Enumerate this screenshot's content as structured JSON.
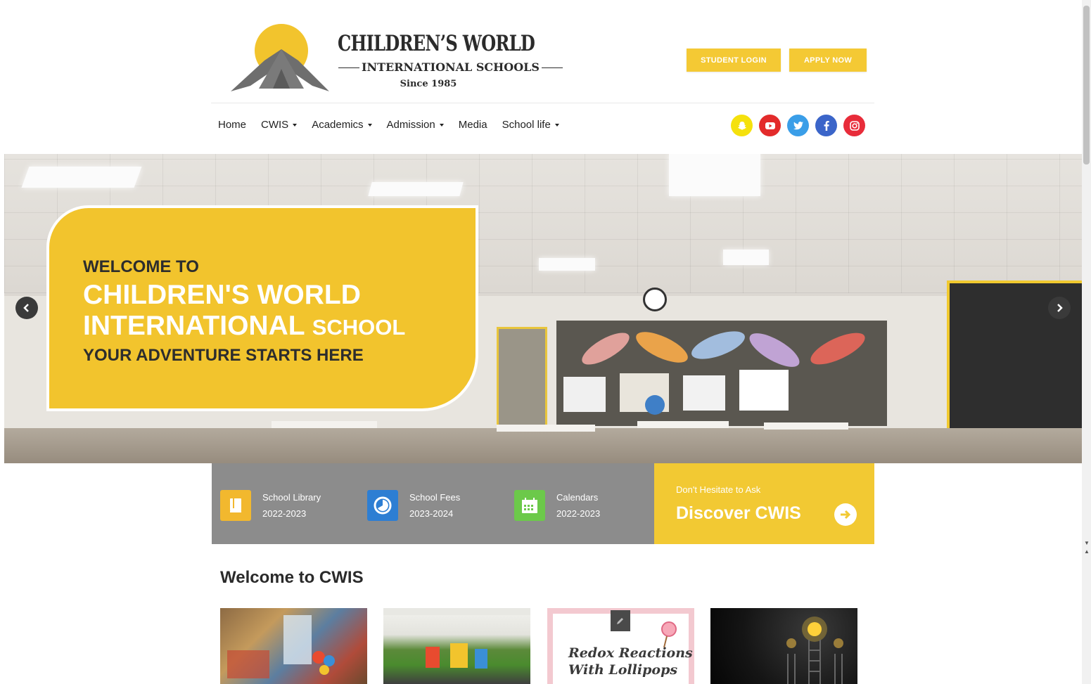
{
  "brand": {
    "title": "CHILDREN’S WORLD",
    "subtitle": "INTERNATIONAL SCHOOLS",
    "since": "Since 1985",
    "sun_color": "#f2c42d",
    "mountain_color": "#6e6e6e"
  },
  "header_buttons": {
    "student_login": "STUDENT LOGIN",
    "apply_now": "APPLY NOW",
    "color": "#f4c934"
  },
  "nav": {
    "items": [
      {
        "label": "Home",
        "dropdown": false
      },
      {
        "label": "CWIS",
        "dropdown": true
      },
      {
        "label": "Academics",
        "dropdown": true
      },
      {
        "label": "Admission",
        "dropdown": true
      },
      {
        "label": "Media",
        "dropdown": false
      },
      {
        "label": "School life",
        "dropdown": true
      }
    ]
  },
  "social": [
    {
      "name": "snapchat-icon",
      "color": "#f5e10d"
    },
    {
      "name": "youtube-icon",
      "color": "#e32b2b"
    },
    {
      "name": "twitter-icon",
      "color": "#3a9ee8"
    },
    {
      "name": "facebook-icon",
      "color": "#3b65c9"
    },
    {
      "name": "instagram-icon",
      "color": "#e82c3a"
    }
  ],
  "hero": {
    "line1": "WELCOME TO",
    "line2": "CHILDREN'S WORLD",
    "line3_big": "INTERNATIONAL",
    "line3_small": "SCHOOL",
    "line4": "YOUR ADVENTURE STARTS HERE",
    "card_color": "#f2c42d"
  },
  "info_bar": {
    "items": [
      {
        "title": "School Library",
        "year": "2022-2023",
        "icon": "book-icon",
        "color": "#f2b82e"
      },
      {
        "title": "School Fees",
        "year": "2023-2024",
        "icon": "pie-chart-icon",
        "color": "#2d7ed3"
      },
      {
        "title": "Calendars",
        "year": "2022-2023",
        "icon": "calendar-icon",
        "color": "#6cc94a"
      }
    ],
    "background": "#8c8c8c"
  },
  "discover": {
    "small": "Don't Hesitate to Ask",
    "big": "Discover CWIS",
    "color": "#f2c933"
  },
  "welcome_section": {
    "title": "Welcome to CWIS",
    "thumb3_line1": "Redox Reactions",
    "thumb3_line2": "With Lollipops"
  }
}
